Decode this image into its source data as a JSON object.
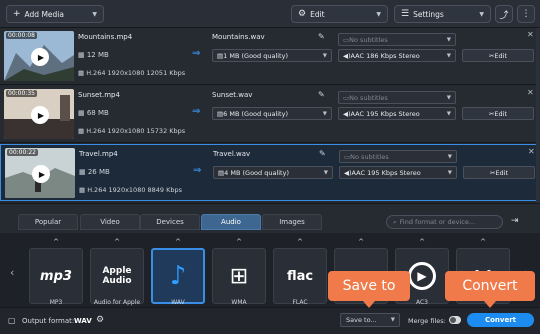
{
  "toolbar": {
    "add_media": "Add Media",
    "edit": "Edit",
    "settings": "Settings"
  },
  "files": [
    {
      "time": "00:00:08",
      "name": "Mountains.mp4",
      "size": "12 MB",
      "info": "H.264 1920x1080 12051 Kbps",
      "output_name": "Mountains.wav",
      "output_quality": "1 MB (Good quality)",
      "subtitles": "No subtitles",
      "audio": "AAC 186 Kbps Stereo",
      "edit": "Edit"
    },
    {
      "time": "00:00:35",
      "name": "Sunset.mp4",
      "size": "68 MB",
      "info": "H.264 1920x1080 15732 Kbps",
      "output_name": "Sunset.wav",
      "output_quality": "6 MB (Good quality)",
      "subtitles": "No subtitles",
      "audio": "AAC 195 Kbps Stereo",
      "edit": "Edit"
    },
    {
      "time": "00:00:22",
      "name": "Travel.mp4",
      "size": "26 MB",
      "info": "H.264 1920x1080 8849 Kbps",
      "output_name": "Travel.wav",
      "output_quality": "4 MB (Good quality)",
      "subtitles": "No subtitles",
      "audio": "AAC 195 Kbps Stereo",
      "edit": "Edit"
    }
  ],
  "tabs": [
    "Popular",
    "Video",
    "Devices",
    "Audio",
    "Images"
  ],
  "search_placeholder": "Find format or device...",
  "formats": [
    {
      "label": "MP3",
      "text": "mp3"
    },
    {
      "label": "Audio for Apple",
      "text": "Apple Audio"
    },
    {
      "label": "WAV",
      "text": "♪"
    },
    {
      "label": "WMA",
      "text": "⊞"
    },
    {
      "label": "FLAC",
      "text": "flac"
    },
    {
      "label": "",
      "text": ""
    },
    {
      "label": "AC3",
      "text": "▶"
    },
    {
      "label": "",
      "text": "{ }"
    }
  ],
  "status": {
    "output_format_label": "Output format:",
    "output_format_value": "WAV",
    "save_to": "Save to...",
    "merge_files": "Merge files:",
    "convert": "Convert"
  },
  "callouts": {
    "save_to": "Save to",
    "convert": "Convert"
  },
  "colors": {
    "accent": "#3a8ee6",
    "callout": "#f07a4a",
    "convert": "#1d8cf0"
  }
}
